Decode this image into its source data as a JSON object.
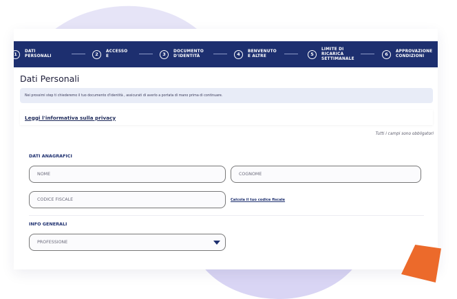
{
  "stepper": {
    "steps": [
      {
        "num": "1",
        "label": "DATI PERSONALI"
      },
      {
        "num": "2",
        "label": "ACCESSO E"
      },
      {
        "num": "3",
        "label": "DOCUMENTO D'IDENTITÀ"
      },
      {
        "num": "4",
        "label": "BENVENUTO E ALTRE"
      },
      {
        "num": "5",
        "label": "LIMITE DI RICARICA SETTIMANALE"
      },
      {
        "num": "6",
        "label": "APPROVAZIONE CONDIZIONI"
      }
    ]
  },
  "page": {
    "title": "Dati Personali",
    "info": "Nei prossimi step ti chiederemo il tuo documento d'identità , assicurati di averlo a portata di mano prima di continuare.",
    "privacy_link": "Leggi l'informativa sulla privacy",
    "required_note": "Tutti i campi sono obbligatori"
  },
  "anagrafici": {
    "heading": "DATI ANAGRAFICI",
    "nome_placeholder": "NOME",
    "cognome_placeholder": "COGNOME",
    "cf_placeholder": "CODICE FISCALE",
    "calc_link": "Calcola il tuo codice fiscale"
  },
  "info_generali": {
    "heading": "INFO GENERALI",
    "professione": "PROFESSIONE"
  },
  "colors": {
    "stepper_bg": "#1d2f6f",
    "accent_orange": "#ec6a2b",
    "lavender": "#d9d5f4"
  }
}
